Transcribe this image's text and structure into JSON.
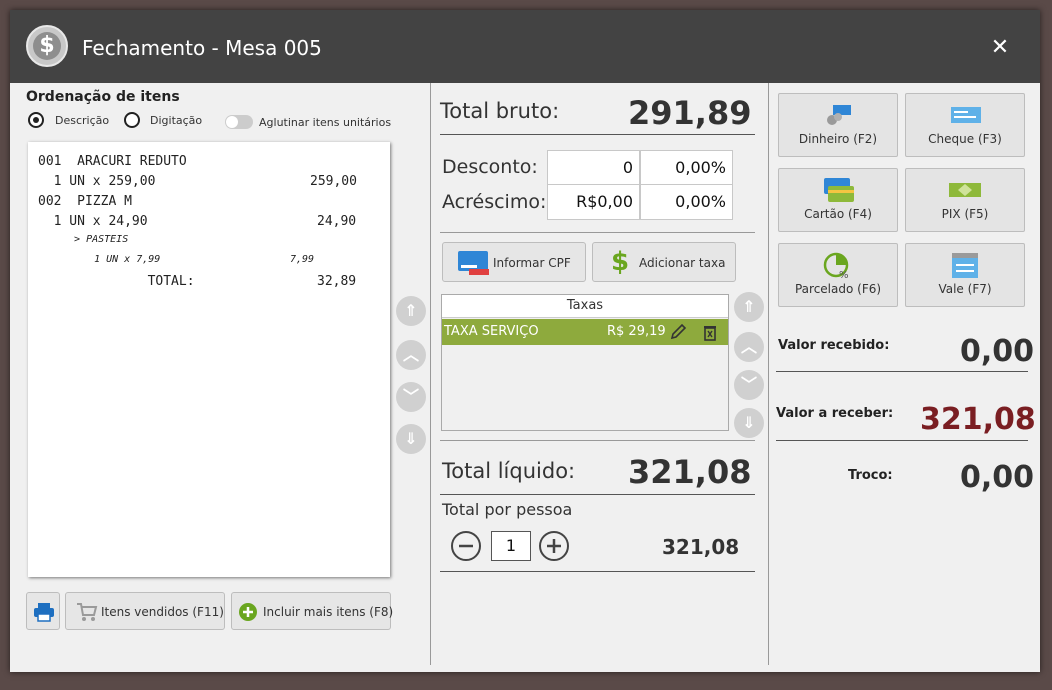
{
  "window": {
    "title": "Fechamento - Mesa 005",
    "close_label": "✕"
  },
  "ordering": {
    "title": "Ordenação de itens",
    "option_descricao": "Descrição",
    "option_digitacao": "Digitação",
    "selected": "Descrição",
    "aglutinar_label": "Aglutinar itens unitários"
  },
  "receipt": {
    "lines": [
      "001  ARACURI REDUTO",
      "  1 UN x 259,00",
      "002  PIZZA M",
      "  1 UN x 24,90",
      "  > PASTEIS",
      "    1 UN x 7,99",
      "              TOTAL:"
    ],
    "amounts": [
      "259,00",
      "24,90",
      "7,99",
      "32,89"
    ]
  },
  "left_buttons": {
    "print_icon": "printer-icon",
    "itens_vendidos": "Itens vendidos (F11)",
    "incluir_mais": "Incluir mais itens (F8)"
  },
  "totals": {
    "total_bruto_label": "Total bruto:",
    "total_bruto": "291,89",
    "desconto_label": "Desconto:",
    "desconto_valor": "0",
    "desconto_pct": "0,00%",
    "acrescimo_label": "Acréscimo:",
    "acrescimo_valor": "R$0,00",
    "acrescimo_pct": "0,00%",
    "informar_cpf": "Informar CPF",
    "adicionar_taxa": "Adicionar taxa",
    "taxas_header": "Taxas",
    "taxas": [
      {
        "name": "TAXA SERVIÇO",
        "value": "R$ 29,19"
      }
    ],
    "total_liquido_label": "Total líquido:",
    "total_liquido": "321,08",
    "total_por_pessoa_label": "Total por pessoa",
    "pessoas": "1",
    "total_por_pessoa": "321,08"
  },
  "payment": {
    "methods": [
      "Dinheiro (F2)",
      "Cheque (F3)",
      "Cartão (F4)",
      "PIX (F5)",
      "Parcelado (F6)",
      "Vale (F7)"
    ],
    "valor_recebido_label": "Valor recebido:",
    "valor_recebido": "0,00",
    "valor_a_receber_label": "Valor a receber:",
    "valor_a_receber": "321,08",
    "troco_label": "Troco:",
    "troco": "0,00"
  },
  "colors": {
    "titlebar": "#434343",
    "taxa_row": "#8eaa3d",
    "a_receber": "#7a1e22"
  }
}
